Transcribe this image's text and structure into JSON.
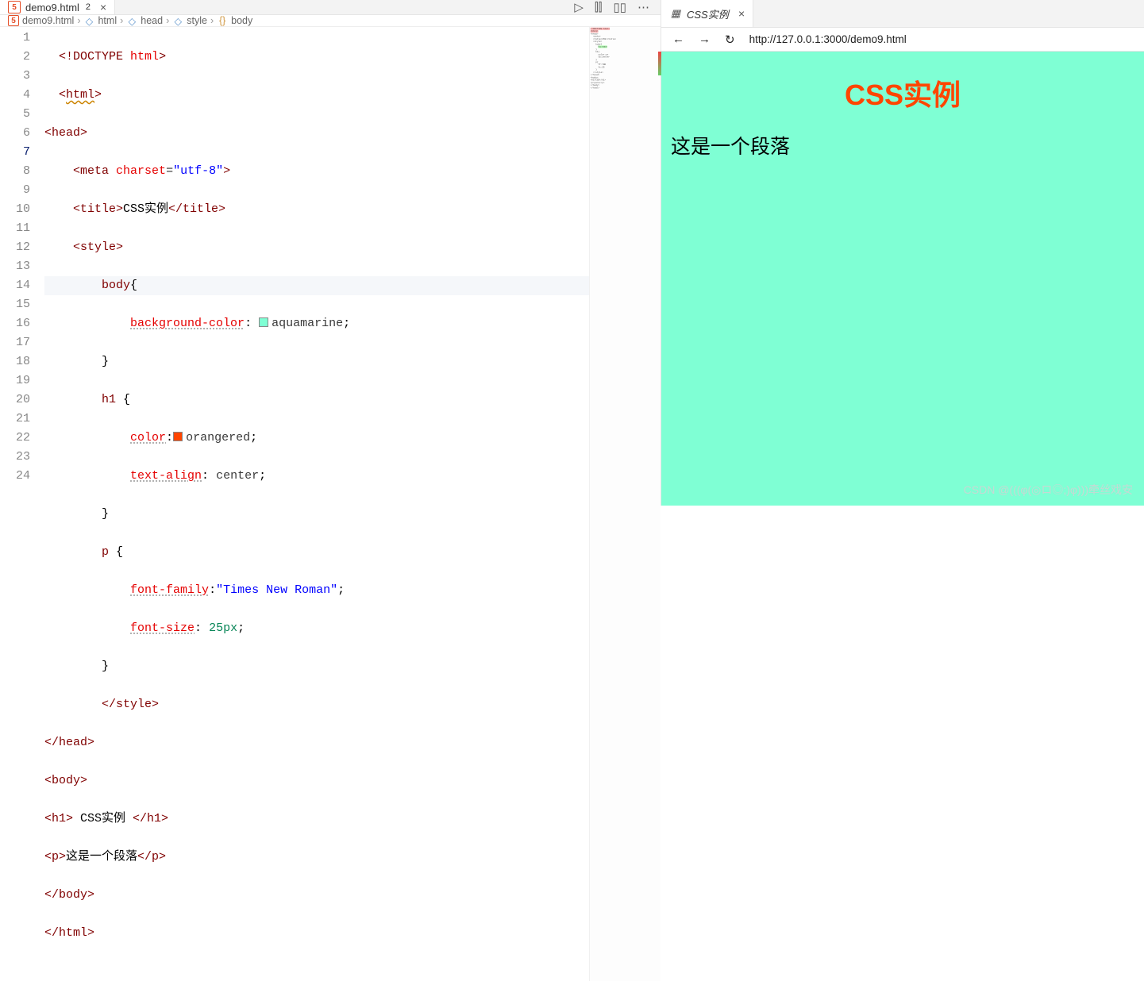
{
  "editor": {
    "tab": {
      "filename": "demo9.html",
      "dirty_badge": "2"
    },
    "actions": {
      "run": "▷",
      "split_preview": "⫿⫿",
      "split": "▯▯",
      "more": "⋯"
    },
    "breadcrumb": [
      {
        "icon": "html5",
        "label": "demo9.html"
      },
      {
        "icon": "cube",
        "label": "html"
      },
      {
        "icon": "cube",
        "label": "head"
      },
      {
        "icon": "cube",
        "label": "style"
      },
      {
        "icon": "brace",
        "label": "body"
      }
    ],
    "code": {
      "lines": [
        1,
        2,
        3,
        4,
        5,
        6,
        7,
        8,
        9,
        10,
        11,
        12,
        13,
        14,
        15,
        16,
        17,
        18,
        19,
        20,
        21,
        22,
        23,
        24
      ],
      "active_line": 7,
      "l1_doctype": "<!DOCTYPE html>",
      "l4_charset_attr": "charset",
      "l4_charset_val": "\"utf-8\"",
      "l5_title_text": "CSS实例",
      "l7_selector": "body",
      "l8_prop": "background-color",
      "l8_val": "aquamarine",
      "l10_selector": "h1",
      "l11_prop": "color",
      "l11_val": "orangered",
      "l12_prop": "text-align",
      "l12_val": "center",
      "l14_selector": "p",
      "l15_prop": "font-family",
      "l15_val": "\"Times New Roman\"",
      "l16_prop": "font-size",
      "l16_val": "25px",
      "l21_text": " CSS实例 ",
      "l22_text": "这是一个段落"
    }
  },
  "preview": {
    "tab": {
      "title": "CSS实例"
    },
    "nav": {
      "back": "←",
      "forward": "→",
      "reload": "↻"
    },
    "url": "http://127.0.0.1:3000/demo9.html",
    "page": {
      "heading": "CSS实例",
      "paragraph": "这是一个段落"
    },
    "watermark": "CSDN @(((φ(◎ロ◎;)φ)))牵丝戏安"
  }
}
